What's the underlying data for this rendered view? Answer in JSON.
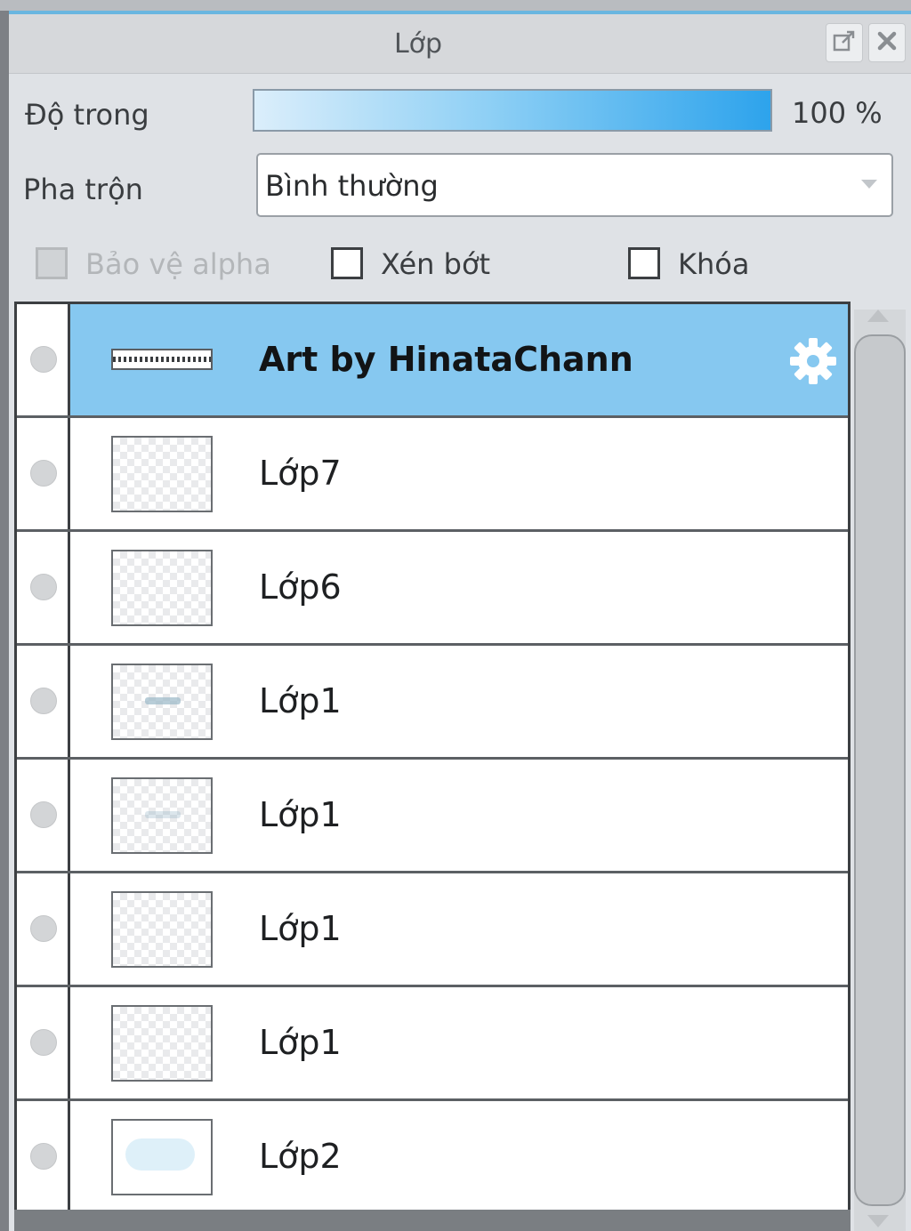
{
  "panel": {
    "title": "Lớp"
  },
  "opacity": {
    "label": "Độ trong",
    "value_text": "100 %",
    "value_percent": 100
  },
  "blend": {
    "label": "Pha trộn",
    "selected": "Bình thường"
  },
  "options": {
    "protect_alpha": {
      "label": "Bảo vệ alpha",
      "checked": false,
      "disabled": true
    },
    "clipping": {
      "label": "Xén bớt",
      "checked": false
    },
    "lock": {
      "label": "Khóa",
      "checked": false
    }
  },
  "layers": [
    {
      "name": "Art by HinataChann",
      "selected": true,
      "thumb": "text-strip"
    },
    {
      "name": "Lớp7",
      "selected": false,
      "thumb": "transparent"
    },
    {
      "name": "Lớp6",
      "selected": false,
      "thumb": "transparent"
    },
    {
      "name": "Lớp1",
      "selected": false,
      "thumb": "small-mark"
    },
    {
      "name": "Lớp1",
      "selected": false,
      "thumb": "small-mark-faint"
    },
    {
      "name": "Lớp1",
      "selected": false,
      "thumb": "transparent"
    },
    {
      "name": "Lớp1",
      "selected": false,
      "thumb": "transparent"
    },
    {
      "name": "Lớp2",
      "selected": false,
      "thumb": "blue-wash"
    }
  ],
  "icons": {
    "popout": "popout-icon",
    "close": "close-icon",
    "settings": "gear-icon",
    "dropdown": "chevron-down-icon"
  },
  "colors": {
    "accent": "#2da3ec",
    "selected_row": "#86c8f0"
  }
}
